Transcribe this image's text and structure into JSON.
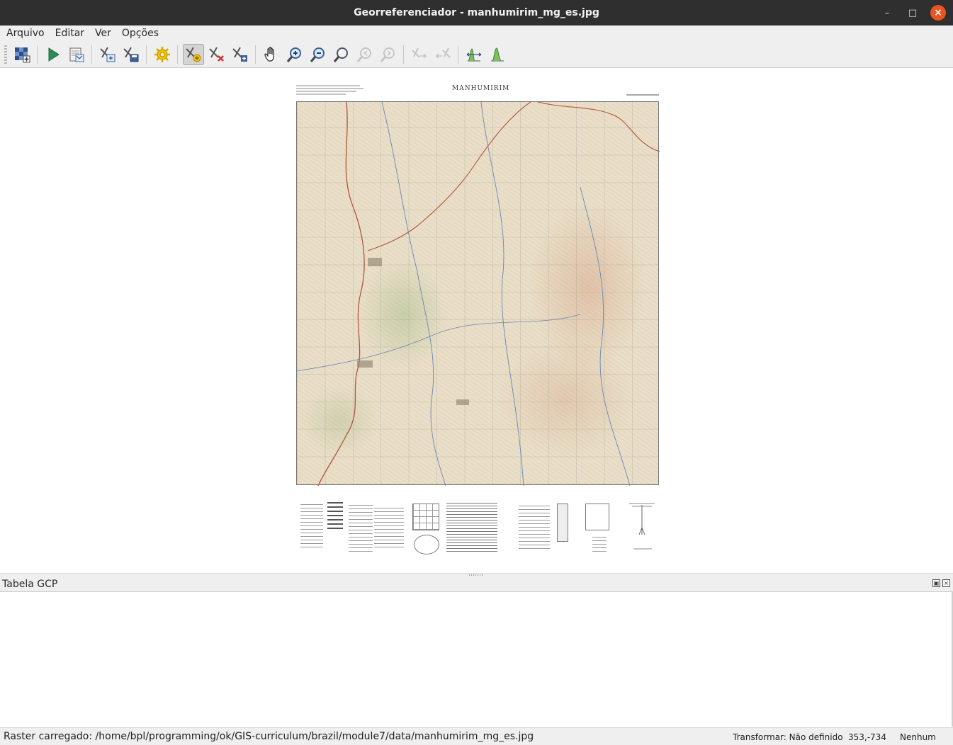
{
  "window": {
    "title": "Georreferenciador - manhumirim_mg_es.jpg",
    "controls": [
      "minimize-icon",
      "maximize-icon",
      "close-icon"
    ]
  },
  "menu": {
    "items": [
      "Arquivo",
      "Editar",
      "Ver",
      "Opções"
    ]
  },
  "toolbar": {
    "buttons": [
      {
        "icon": "open-raster-icon"
      },
      {
        "icon": "play-icon"
      },
      {
        "icon": "generate-gdal-script-icon"
      },
      {
        "icon": "load-gcp-points-icon"
      },
      {
        "icon": "save-gcp-points-icon"
      },
      {
        "icon": "transformation-settings-icon"
      },
      {
        "icon": "add-point-icon",
        "active": true
      },
      {
        "icon": "delete-point-icon"
      },
      {
        "icon": "move-point-icon"
      },
      {
        "icon": "pan-icon"
      },
      {
        "icon": "zoom-in-icon"
      },
      {
        "icon": "zoom-out-icon"
      },
      {
        "icon": "zoom-to-layer-icon"
      },
      {
        "icon": "zoom-last-icon",
        "disabled": true
      },
      {
        "icon": "zoom-next-icon",
        "disabled": true
      },
      {
        "icon": "link-georeferencer-to-qgis-icon",
        "disabled": true
      },
      {
        "icon": "link-qgis-to-georeferencer-icon",
        "disabled": true
      },
      {
        "icon": "full-histogram-stretch-icon"
      },
      {
        "icon": "local-histogram-stretch-icon"
      }
    ]
  },
  "canvas": {
    "map_title": "MANHUMIRIM"
  },
  "gcp_panel": {
    "title": "Tabela GCP"
  },
  "statusbar": {
    "message": "Raster carregado: /home/bpl/programming/ok/GIS-curriculum/brazil/module7/data/manhumirim_mg_es.jpg",
    "transform": "Transformar: Não definido",
    "coordinates": "353,-734",
    "crs": "Nenhum"
  },
  "colors": {
    "titlebar": "#2f2f2f",
    "close_button": "#e95420",
    "chrome": "#efefef",
    "map_paper": "#e9dfc8"
  }
}
